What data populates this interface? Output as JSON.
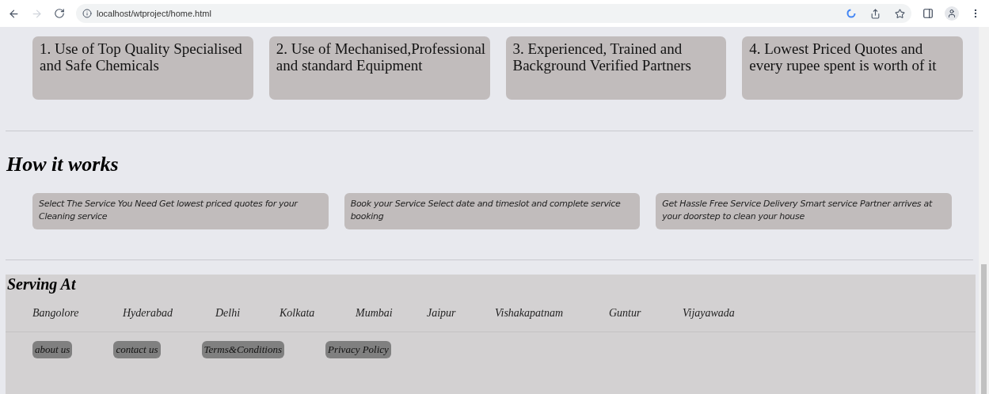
{
  "browser": {
    "url": "localhost/wtproject/home.html"
  },
  "features": [
    {
      "text": "1. Use of Top Quality Specialised and Safe Chemicals"
    },
    {
      "text": "2. Use of Mechanised,Professional and standard Equipment"
    },
    {
      "text": "3. Experienced, Trained and Background Verified Partners"
    },
    {
      "text": "4. Lowest Priced Quotes and every rupee spent is worth of it"
    }
  ],
  "how_it_works": {
    "title": "How it works",
    "steps": [
      {
        "text": "Select The Service You Need Get lowest priced quotes for your Cleaning service"
      },
      {
        "text": "Book your Service Select date and timeslot and complete service booking"
      },
      {
        "text": "Get Hassle Free Service Delivery Smart service Partner arrives at your doorstep to clean your house"
      }
    ]
  },
  "footer": {
    "title": "Serving At",
    "cities": [
      "Bangolore",
      "Hyderabad",
      "Delhi",
      "Kolkata",
      "Mumbai",
      "Jaipur",
      "Vishakapatnam",
      "Guntur",
      "Vijayawada"
    ],
    "links": [
      "about us",
      "contact us",
      "Terms&Conditions",
      "Privacy Policy"
    ]
  }
}
